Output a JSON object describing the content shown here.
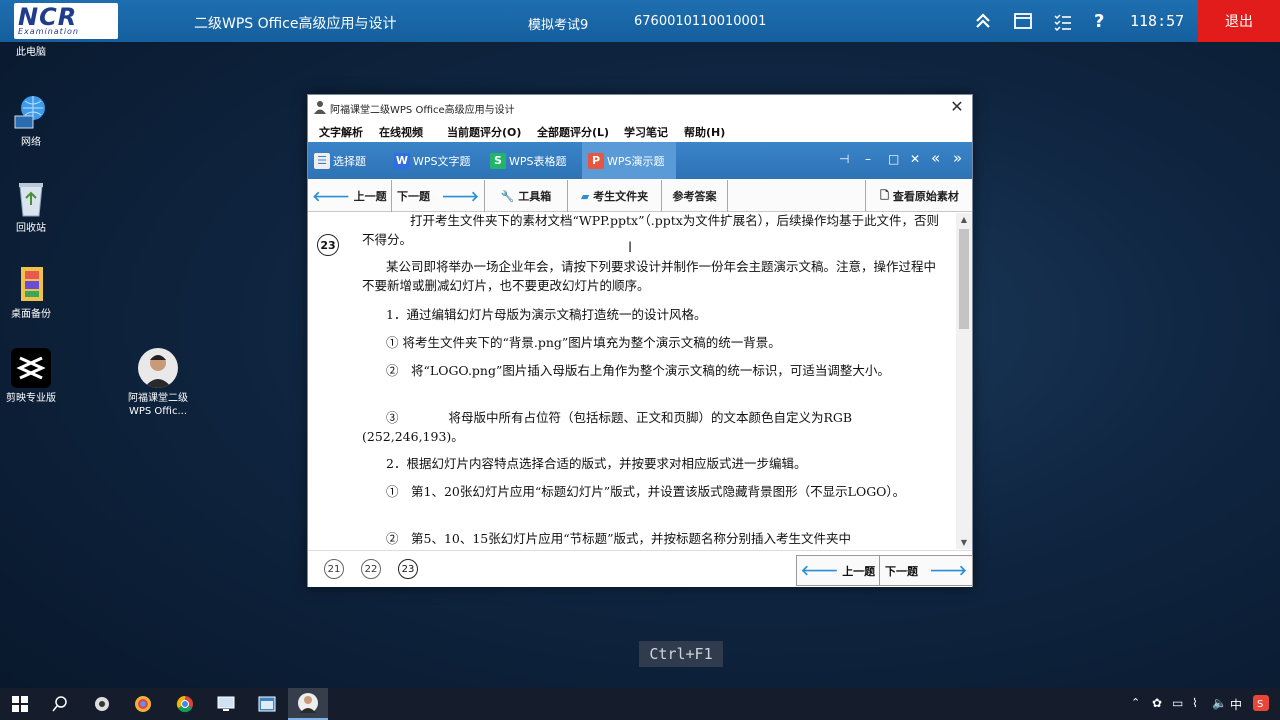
{
  "exam_bar": {
    "logo_text": "NCR",
    "logo_sub": "Examination",
    "title": "二级WPS Office高级应用与设计",
    "exam_name": "模拟考试9",
    "exam_id": "6760010110010001",
    "timer": "118:57",
    "exit_label": "退出"
  },
  "desktop": {
    "icons": [
      {
        "label": "此电脑"
      },
      {
        "label": "网络"
      },
      {
        "label": "回收站"
      },
      {
        "label": "桌面备份"
      },
      {
        "label": "剪映专业版"
      },
      {
        "label": "阿福课堂二级\nWPS Offic..."
      }
    ]
  },
  "window": {
    "title": "阿福课堂二级WPS Office高级应用与设计",
    "menu": [
      "文字解析",
      "在线视频",
      "当前题评分(O)",
      "全部题评分(L)",
      "学习笔记",
      "帮助(H)"
    ],
    "tabs": [
      "选择题",
      "WPS文字题",
      "WPS表格题",
      "WPS演示题"
    ],
    "active_tab": "WPS演示题",
    "toolbar": {
      "prev": "上一题",
      "next": "下一题",
      "tools": "工具箱",
      "folder": "考生文件夹",
      "answer": "参考答案",
      "original": "查看原始素材"
    },
    "question_number": "23",
    "paragraphs": [
      "打开考生文件夹下的素材文档“WPP.pptx”（.pptx为文件扩展名），后续操作均基于此文件，否则不得分。",
      "某公司即将举办一场企业年会，请按下列要求设计并制作一份年会主题演示文稿。注意，操作过程中不要新增或删减幻灯片，也不要更改幻灯片的顺序。",
      "1．通过编辑幻灯片母版为演示文稿打造统一的设计风格。",
      "① 将考生文件夹下的“背景.png”图片填充为整个演示文稿的统一背景。",
      "②　将“LOGO.png”图片插入母版右上角作为整个演示文稿的统一标识，可适当调整大小。",
      "③　　　　将母版中所有占位符（包括标题、正文和页脚）的文本颜色自定义为RGB (252,246,193)。",
      "2．根据幻灯片内容特点选择合适的版式，并按要求对相应版式进一步编辑。",
      "①　第1、20张幻灯片应用“标题幻灯片”版式，并设置该版式隐藏背景图形（不显示LOGO）。",
      "②　第5、10、15张幻灯片应用“节标题”版式，并按标题名称分别插入考生文件夹中"
    ],
    "question_list": [
      "21",
      "22",
      "23"
    ],
    "bottom_prev": "上一题",
    "bottom_next": "下一题"
  },
  "ctrl_hint": "Ctrl+F1",
  "taskbar": {
    "tray_lang": "中"
  },
  "colors": {
    "exam_bar": "#1e6fb0",
    "exit": "#e21b1b",
    "tab_bar": "#3b84c8",
    "arrow": "#2a8fd6"
  }
}
